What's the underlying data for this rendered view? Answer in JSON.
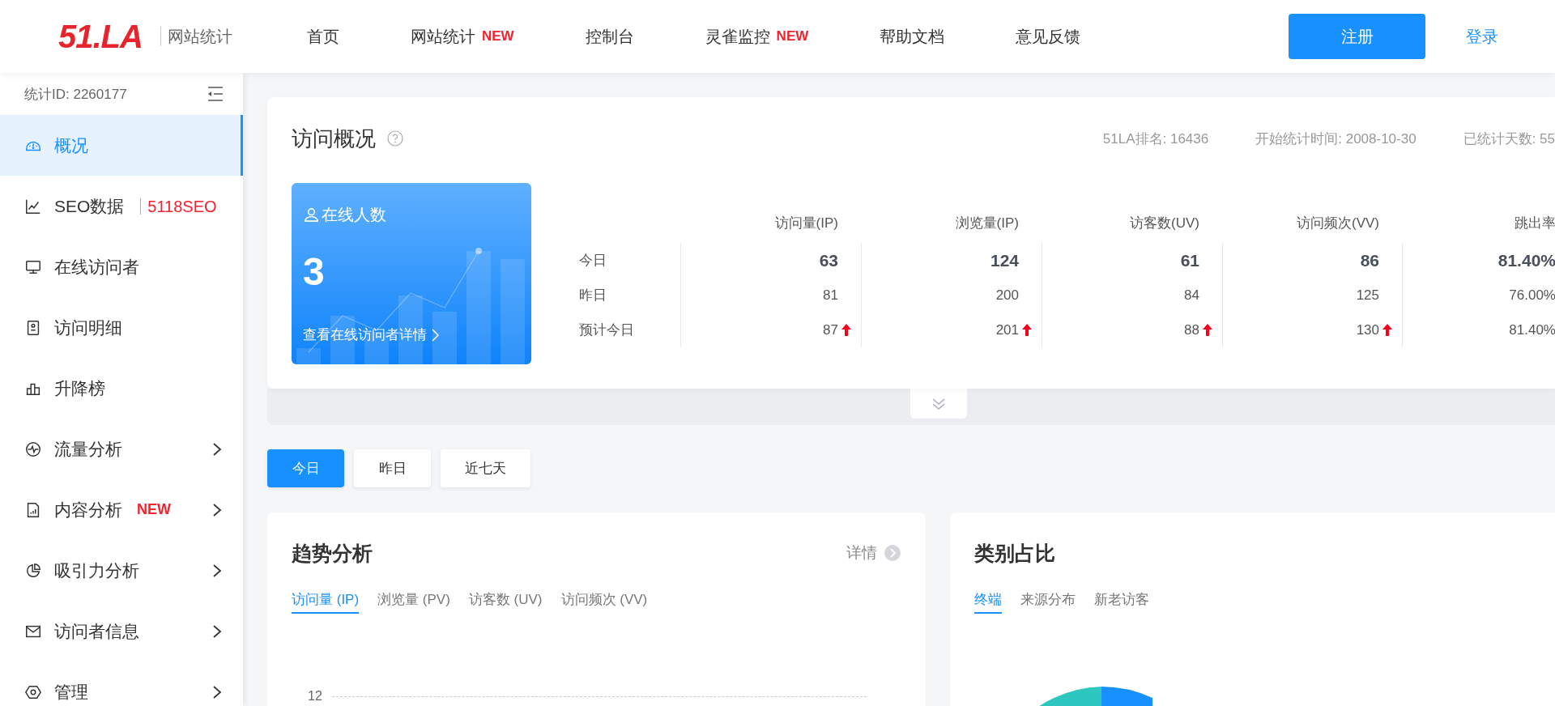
{
  "header": {
    "logo": "51.LA",
    "product": "网站统计",
    "nav": [
      {
        "label": "首页"
      },
      {
        "label": "网站统计",
        "badge": "NEW"
      },
      {
        "label": "控制台"
      },
      {
        "label": "灵雀监控",
        "badge": "NEW"
      },
      {
        "label": "帮助文档"
      },
      {
        "label": "意见反馈"
      }
    ],
    "register": "注册",
    "login": "登录"
  },
  "sidebar": {
    "site_id": "统计ID: 2260177",
    "items": [
      {
        "label": "概况",
        "selected": true,
        "expandable": false
      },
      {
        "label": "SEO数据",
        "selected": false,
        "expandable": false,
        "tag": {
          "kind": "partner",
          "text": "5118SEO"
        }
      },
      {
        "label": "在线访问者",
        "selected": false,
        "expandable": false
      },
      {
        "label": "访问明细",
        "selected": false,
        "expandable": false
      },
      {
        "label": "升降榜",
        "selected": false,
        "expandable": false
      },
      {
        "label": "流量分析",
        "selected": false,
        "expandable": true
      },
      {
        "label": "内容分析",
        "selected": false,
        "expandable": true,
        "tag": {
          "kind": "new",
          "text": "NEW"
        }
      },
      {
        "label": "吸引力分析",
        "selected": false,
        "expandable": true
      },
      {
        "label": "访问者信息",
        "selected": false,
        "expandable": true
      },
      {
        "label": "管理",
        "selected": false,
        "expandable": true
      }
    ]
  },
  "overview": {
    "title": "访问概况",
    "meta": [
      "51LA排名: 16436",
      "开始统计时间: 2008-10-30",
      "已统计天数: 55"
    ],
    "online": {
      "title": "在线人数",
      "count": "3",
      "link": "查看在线访问者详情"
    },
    "columns": [
      "访问量(IP)",
      "浏览量(IP)",
      "访客数(UV)",
      "访问频次(VV)",
      "跳出率"
    ],
    "rows": [
      {
        "label": "今日",
        "bold": true,
        "cells": [
          {
            "value": "63",
            "rising": false
          },
          {
            "value": "124",
            "rising": false
          },
          {
            "value": "61",
            "rising": false
          },
          {
            "value": "86",
            "rising": false
          },
          {
            "value": "81.40%",
            "rising": false
          }
        ]
      },
      {
        "label": "昨日",
        "bold": false,
        "cells": [
          {
            "value": "81",
            "rising": false
          },
          {
            "value": "200",
            "rising": false
          },
          {
            "value": "84",
            "rising": false
          },
          {
            "value": "125",
            "rising": false
          },
          {
            "value": "76.00%",
            "rising": false
          }
        ]
      },
      {
        "label": "预计今日",
        "bold": false,
        "cells": [
          {
            "value": "87",
            "rising": true
          },
          {
            "value": "201",
            "rising": true
          },
          {
            "value": "88",
            "rising": true
          },
          {
            "value": "130",
            "rising": true
          },
          {
            "value": "81.40%",
            "rising": false
          }
        ]
      }
    ]
  },
  "periods": [
    {
      "label": "今日",
      "selected": true
    },
    {
      "label": "昨日",
      "selected": false
    },
    {
      "label": "近七天",
      "selected": false
    }
  ],
  "trend": {
    "title": "趋势分析",
    "details": "详情",
    "tabs": [
      {
        "label": "访问量 (IP)",
        "selected": true
      },
      {
        "label": "浏览量 (PV)",
        "selected": false
      },
      {
        "label": "访客数 (UV)",
        "selected": false
      },
      {
        "label": "访问频次 (VV)",
        "selected": false
      }
    ],
    "axis_label": "12"
  },
  "category": {
    "title": "类别占比",
    "tabs": [
      {
        "label": "终端",
        "selected": true
      },
      {
        "label": "来源分布",
        "selected": false
      },
      {
        "label": "新老访客",
        "selected": false
      }
    ]
  }
}
